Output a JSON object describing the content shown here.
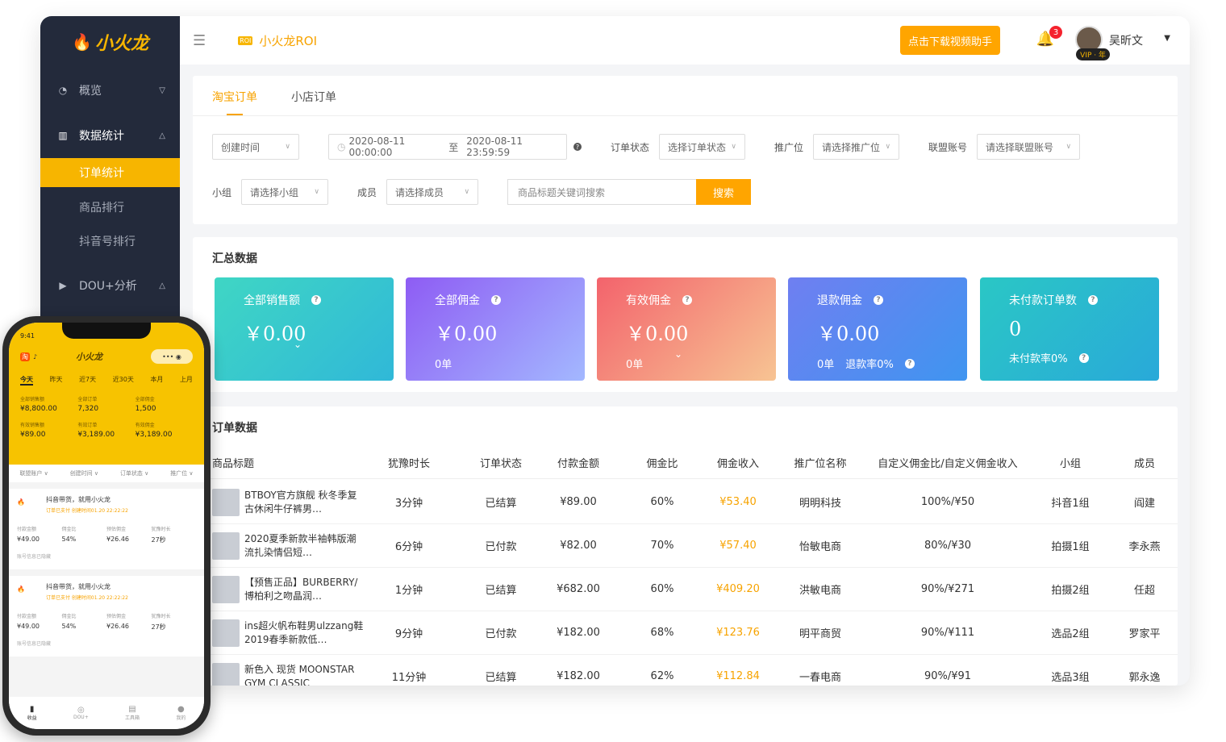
{
  "sidebar": {
    "logo": "小火龙",
    "items": [
      {
        "label": "概览"
      },
      {
        "label": "数据统计"
      },
      {
        "label": "DOU+分析"
      }
    ],
    "sub_items": [
      "订单统计",
      "商品排行",
      "抖音号排行"
    ]
  },
  "header": {
    "roi_badge": "ROI",
    "title": "小火龙ROI",
    "download_label": "点击下载视频助手",
    "notification_count": "3",
    "vip_label": "VIP · 年",
    "username": "吴昕文"
  },
  "filters": {
    "tabs": [
      "淘宝订单",
      "小店订单"
    ],
    "time_type": "创建时间",
    "date_start": "2020-08-11 00:00:00",
    "date_sep": "至",
    "date_end": "2020-08-11 23:59:59",
    "order_status_label": "订单状态",
    "order_status_placeholder": "选择订单状态",
    "promo_label": "推广位",
    "promo_placeholder": "请选择推广位",
    "alliance_label": "联盟账号",
    "alliance_placeholder": "请选择联盟账号",
    "group_label": "小组",
    "group_placeholder": "请选择小组",
    "member_label": "成员",
    "member_placeholder": "请选择成员",
    "keyword_placeholder": "商品标题关键词搜索",
    "search_label": "搜索"
  },
  "summary": {
    "title": "汇总数据",
    "cards": [
      {
        "label": "全部销售额",
        "value": "￥0.00",
        "sub": ""
      },
      {
        "label": "全部佣金",
        "value": "￥0.00",
        "sub": "0单"
      },
      {
        "label": "有效佣金",
        "value": "￥0.00",
        "sub": "0单"
      },
      {
        "label": "退款佣金",
        "value": "￥0.00",
        "sub": "0单",
        "sub2": "退款率0%"
      },
      {
        "label": "未付款订单数",
        "value": "0",
        "sub": "未付款率0%"
      }
    ],
    "colors": [
      "#37d0c8",
      "#8a6cf6",
      "#f4a070",
      "#5b86f2",
      "#2ab9d4"
    ]
  },
  "orders": {
    "title": "订单数据",
    "headers": [
      "商品标题",
      "犹豫时长",
      "订单状态",
      "付款金额",
      "佣金比",
      "佣金收入",
      "推广位名称",
      "自定义佣金比/自定义佣金收入",
      "小组",
      "成员"
    ],
    "rows": [
      {
        "title": "BTBOY官方旗舰 秋冬季复古休闲牛仔裤男…",
        "duration": "3分钟",
        "status": "已结算",
        "amount": "¥89.00",
        "ratio": "60%",
        "commission": "¥53.40",
        "promo": "明明科技",
        "custom": "100%/¥50",
        "group": "抖音1组",
        "member": "阎建"
      },
      {
        "title": "2020夏季新款半袖韩版潮流扎染情侣短…",
        "duration": "6分钟",
        "status": "已付款",
        "amount": "¥82.00",
        "ratio": "70%",
        "commission": "¥57.40",
        "promo": "怡敏电商",
        "custom": "80%/¥30",
        "group": "拍摄1组",
        "member": "李永燕"
      },
      {
        "title": "【预售正品】BURBERRY/博柏利之吻晶润…",
        "duration": "1分钟",
        "status": "已结算",
        "amount": "¥682.00",
        "ratio": "60%",
        "commission": "¥409.20",
        "promo": "洪敏电商",
        "custom": "90%/¥271",
        "group": "拍摄2组",
        "member": "任超"
      },
      {
        "title": "ins超火帆布鞋男ulzzang鞋2019春季新款低…",
        "duration": "9分钟",
        "status": "已付款",
        "amount": "¥182.00",
        "ratio": "68%",
        "commission": "¥123.76",
        "promo": "明平商贸",
        "custom": "90%/¥111",
        "group": "选品2组",
        "member": "罗家平"
      },
      {
        "title": "新色入 现货 MOONSTAR GYM CLASSIC",
        "duration": "11分钟",
        "status": "已结算",
        "amount": "¥182.00",
        "ratio": "62%",
        "commission": "¥112.84",
        "promo": "一春电商",
        "custom": "90%/¥91",
        "group": "选品3组",
        "member": "郭永逸"
      }
    ]
  },
  "phone": {
    "time": "9:41",
    "logo": "小火龙",
    "periods": [
      "今天",
      "昨天",
      "近7天",
      "近30天",
      "本月",
      "上月"
    ],
    "stats": [
      {
        "k": "全部销售额",
        "v": "¥8,800.00"
      },
      {
        "k": "全部订单",
        "v": "7,320"
      },
      {
        "k": "全部佣金",
        "v": "1,500"
      },
      {
        "k": "有效销售额",
        "v": "¥89.00"
      },
      {
        "k": "有效订单",
        "v": "¥3,189.00"
      },
      {
        "k": "有效佣金",
        "v": "¥3,189.00"
      }
    ],
    "filters": [
      "联盟账户",
      "创建时间",
      "订单状态",
      "推广位"
    ],
    "cards": [
      {
        "title": "抖音带货，就用小火龙",
        "tag": "订单已支付  创建时间01.20 22:22:22",
        "k": [
          "付款金额",
          "佣金比",
          "预估佣金",
          "犹豫时长"
        ],
        "v": [
          "¥49.00",
          "54%",
          "¥26.46",
          "27秒"
        ],
        "foot": "账号信息已隐藏"
      },
      {
        "title": "抖音带货，就用小火龙",
        "tag": "订单已支付  创建时间01.20 22:22:22",
        "k": [
          "付款金额",
          "佣金比",
          "预估佣金",
          "犹豫时长"
        ],
        "v": [
          "¥49.00",
          "54%",
          "¥26.46",
          "27秒"
        ],
        "foot": "账号信息已隐藏"
      }
    ],
    "tabbar": [
      "收益",
      "DOU+",
      "工具箱",
      "我的"
    ]
  }
}
